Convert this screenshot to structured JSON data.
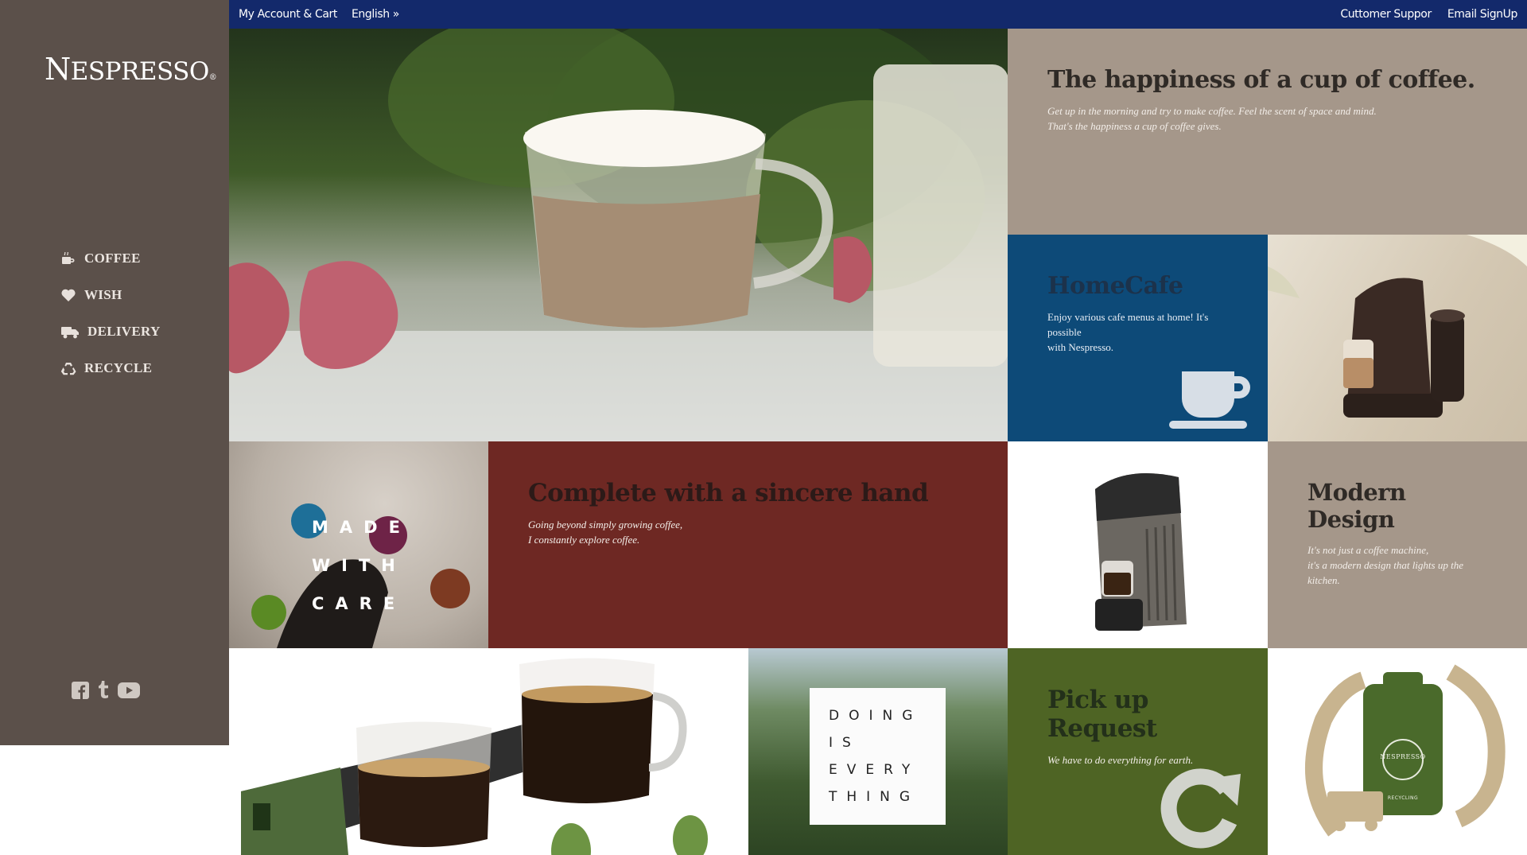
{
  "brand": {
    "logo_text": "NESPRESSO",
    "logo_first": "N",
    "logo_rest": "ESPRESSO",
    "registered": "®"
  },
  "topbar": {
    "account_cart": "My Account & Cart",
    "language": "English",
    "language_chevron": "»",
    "customer_support": "Cuttomer Suppor",
    "email_signup": "Email SignUp"
  },
  "sidebar": {
    "nav": [
      {
        "label": "COFFEE",
        "icon": "coffee-cup-icon"
      },
      {
        "label": "WISH",
        "icon": "heart-icon"
      },
      {
        "label": "DELIVERY",
        "icon": "truck-icon"
      },
      {
        "label": "RECYCLE",
        "icon": "recycle-icon"
      }
    ],
    "social": [
      "facebook-icon",
      "tumblr-icon",
      "youtube-icon"
    ]
  },
  "tiles": {
    "happiness": {
      "title": "The happiness of a cup of coffee.",
      "desc_line1": "Get up in the morning and try to make coffee. Feel the scent of space and mind.",
      "desc_line2": "That's the happiness a cup of coffee gives."
    },
    "homecafe": {
      "title": "HomeCafe",
      "desc_line1": "Enjoy various cafe menus at home! It's possible",
      "desc_line2": "with Nespresso."
    },
    "madewithcare": {
      "line1": "MADE",
      "line2": "WITH",
      "line3": "CARE"
    },
    "complete": {
      "title": "Complete with a sincere hand",
      "desc_line1": "Going beyond simply growing coffee,",
      "desc_line2": "I constantly explore coffee."
    },
    "modern": {
      "title": "Modern Design",
      "desc_line1": "It's not just a coffee machine,",
      "desc_line2": "it's a modern design that lights up the kitchen."
    },
    "doing": {
      "line1": "DOING",
      "line2": "IS",
      "line3": "EVERY",
      "line4": "THING"
    },
    "pickup": {
      "title": "Pick up Request",
      "desc": "We have to do everything for earth."
    },
    "recyclebag": {
      "bag_brand": "NESPRESSO",
      "bag_seal": "RECYCLING"
    }
  },
  "colors": {
    "sidebar_bg": "#5b504a",
    "topbar_bg": "#13296b",
    "tan": "#a5978a",
    "blue": "#0d4a78",
    "burgundy": "#6e2823",
    "green": "#4e6424"
  }
}
